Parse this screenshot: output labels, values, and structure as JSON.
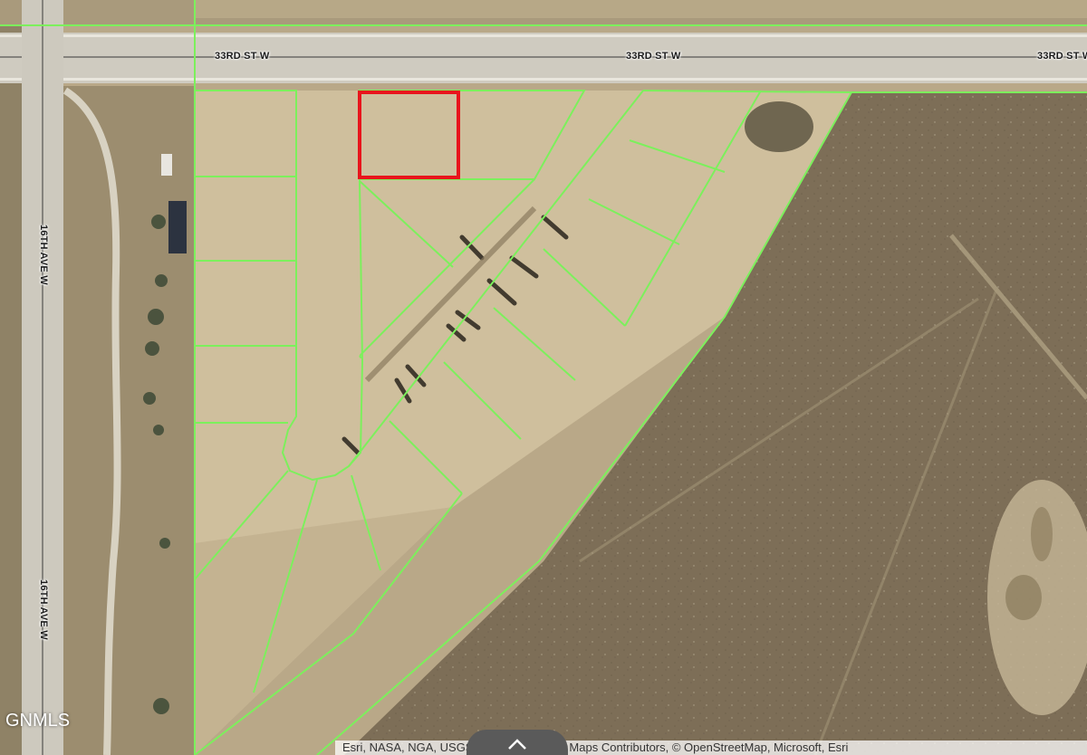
{
  "map": {
    "roads": {
      "horizontal_label_1": "33RD ST W",
      "horizontal_label_2": "33RD ST W",
      "horizontal_label_3": "33RD ST W",
      "vertical_label_1": "16TH AVE W",
      "vertical_label_2": "16TH AVE W"
    },
    "watermark": "GNMLS",
    "attribution": "Esri, NASA, NGA, USGS | Esri Community Maps Contributors, © OpenStreetMap, Microsoft, Esri",
    "colors": {
      "parcel_outline": "#7cf05c",
      "selected_parcel": "#e8141c",
      "ground": "#c9b894",
      "field": "#7a6a52",
      "road": "#d6d2c8"
    },
    "icons": {
      "expand": "chevron-up-icon"
    }
  }
}
